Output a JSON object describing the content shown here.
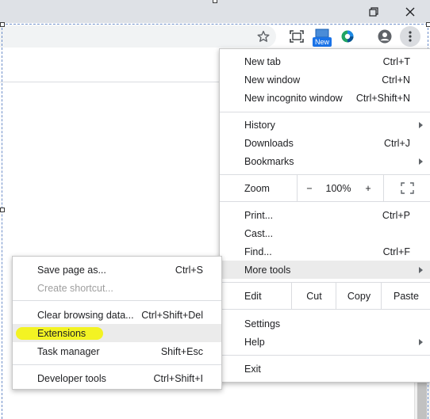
{
  "colors": {
    "titlebar": "#dee1e6",
    "omnibox": "#f1f3f4",
    "hover": "#ebebeb",
    "highlighter": "#f5f500",
    "new_badge": "#1a73e8"
  },
  "toolbar": {
    "new_badge": "New"
  },
  "menu": {
    "new_tab": {
      "label": "New tab",
      "shortcut": "Ctrl+T"
    },
    "new_window": {
      "label": "New window",
      "shortcut": "Ctrl+N"
    },
    "new_incognito": {
      "label": "New incognito window",
      "shortcut": "Ctrl+Shift+N"
    },
    "history": {
      "label": "History"
    },
    "downloads": {
      "label": "Downloads",
      "shortcut": "Ctrl+J"
    },
    "bookmarks": {
      "label": "Bookmarks"
    },
    "zoom": {
      "label": "Zoom",
      "minus": "−",
      "value": "100%",
      "plus": "+"
    },
    "print": {
      "label": "Print...",
      "shortcut": "Ctrl+P"
    },
    "cast": {
      "label": "Cast..."
    },
    "find": {
      "label": "Find...",
      "shortcut": "Ctrl+F"
    },
    "more_tools": {
      "label": "More tools"
    },
    "edit": {
      "label": "Edit",
      "cut": "Cut",
      "copy": "Copy",
      "paste": "Paste"
    },
    "settings": {
      "label": "Settings"
    },
    "help": {
      "label": "Help"
    },
    "exit": {
      "label": "Exit"
    }
  },
  "submenu": {
    "save_page": {
      "label": "Save page as...",
      "shortcut": "Ctrl+S"
    },
    "create_shortcut": {
      "label": "Create shortcut..."
    },
    "clear_browsing": {
      "label": "Clear browsing data...",
      "shortcut": "Ctrl+Shift+Del"
    },
    "extensions": {
      "label": "Extensions"
    },
    "task_manager": {
      "label": "Task manager",
      "shortcut": "Shift+Esc"
    },
    "developer_tools": {
      "label": "Developer tools",
      "shortcut": "Ctrl+Shift+I"
    }
  }
}
